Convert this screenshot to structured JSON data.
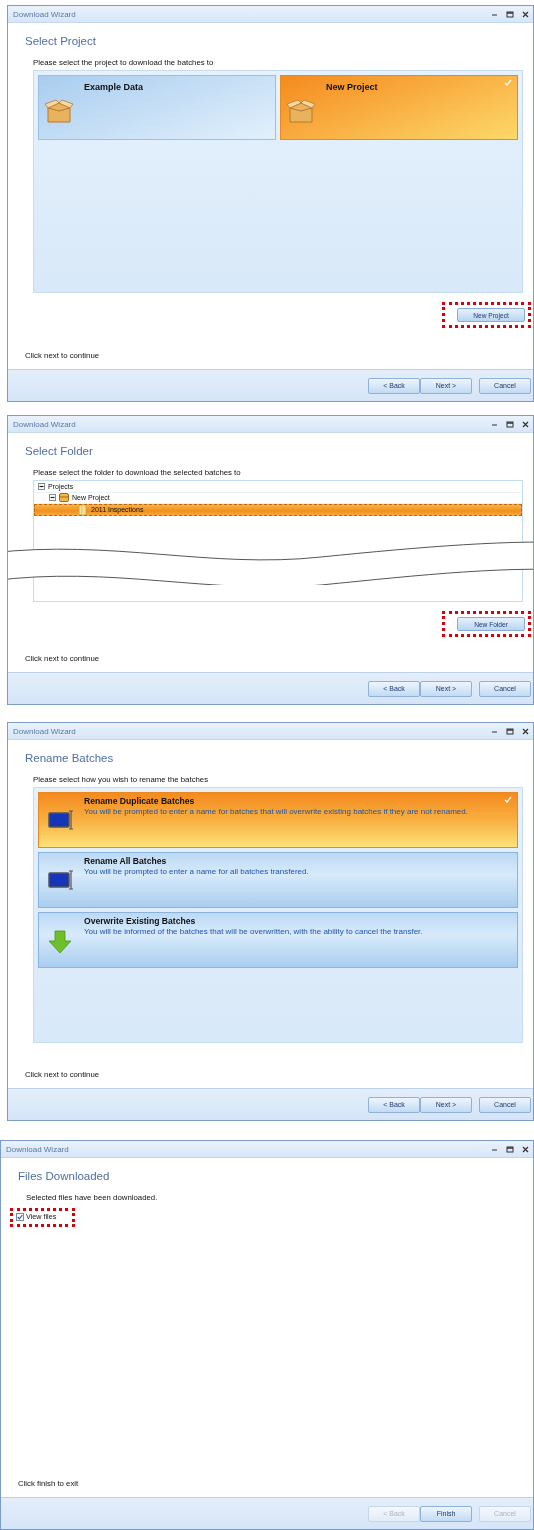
{
  "windows": [
    {
      "title": "Download Wizard",
      "heading": "Select Project",
      "prompt": "Please select the project to download the batches to",
      "torn": false,
      "content": {
        "kind": "tiles",
        "tiles": [
          {
            "label": "Example Data",
            "selected": false
          },
          {
            "label": "New Project",
            "selected": true
          }
        ]
      },
      "action_button": {
        "label": "New Project",
        "highlighted": true
      },
      "footer_text": "Click next to continue",
      "buttons": [
        {
          "label": "< Back",
          "disabled": false
        },
        {
          "label": "Next >",
          "disabled": false
        },
        {
          "label": "Cancel",
          "disabled": false
        }
      ]
    },
    {
      "title": "Download Wizard",
      "heading": "Select Folder",
      "prompt": "Please select the folder to download the selected batches to",
      "torn": true,
      "content": {
        "kind": "tree",
        "tree": [
          {
            "label": "Projects",
            "expanded": true,
            "selected": false,
            "children": [
              {
                "label": "New Project",
                "expanded": true,
                "selected": false,
                "children": [
                  {
                    "label": "2011 Inspections",
                    "selected": true
                  }
                ]
              }
            ]
          }
        ]
      },
      "action_button": {
        "label": "New Folder",
        "highlighted": true
      },
      "footer_text": "Click next to continue",
      "buttons": [
        {
          "label": "< Back",
          "disabled": false
        },
        {
          "label": "Next >",
          "disabled": false
        },
        {
          "label": "Cancel",
          "disabled": false
        }
      ]
    },
    {
      "title": "Download Wizard",
      "heading": "Rename Batches",
      "prompt": "Please select how you wish to rename the batches",
      "torn": false,
      "content": {
        "kind": "options",
        "options": [
          {
            "kind": "rename",
            "title": "Rename Duplicate Batches",
            "description": "You will be prompted to enter a name for batches that will overwrite existing batches if they are not renamed.",
            "selected": true
          },
          {
            "kind": "rename",
            "title": "Rename All Batches",
            "description": "You will be prompted to enter a name for all batches transfered.",
            "selected": false
          },
          {
            "kind": "overwrite",
            "title": "Overwrite Existing Batches",
            "description": "You will be informed of the batches that will be overwritten, with the ability to cancel the transfer.",
            "selected": false
          }
        ]
      },
      "footer_text": "Click next to continue",
      "buttons": [
        {
          "label": "< Back",
          "disabled": false
        },
        {
          "label": "Next >",
          "disabled": false
        },
        {
          "label": "Cancel",
          "disabled": false
        }
      ]
    },
    {
      "title": "Download Wizard",
      "heading": "Files Downloaded",
      "prompt": "Selected files have been downloaded.",
      "torn": false,
      "content": {
        "kind": "checkbox",
        "checkbox": {
          "label": "View files",
          "checked": true,
          "highlighted": true
        }
      },
      "footer_text": "Click finish to exit",
      "buttons": [
        {
          "label": "< Back",
          "disabled": true
        },
        {
          "label": "Finish",
          "disabled": false
        },
        {
          "label": "Cancel",
          "disabled": true
        }
      ]
    }
  ]
}
